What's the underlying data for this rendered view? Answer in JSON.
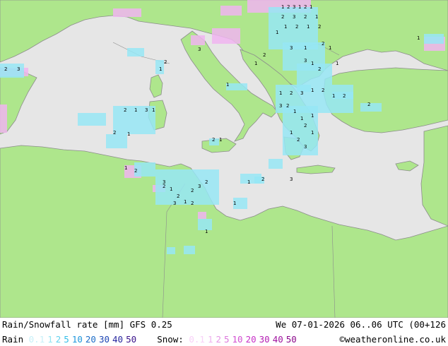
{
  "title": "Rain/Snowfall rate [mm] GFS 0.25",
  "valid_time": "We 07-01-2026 06..06 UTC (00+126",
  "rain_legend": {
    "label": "Rain",
    "items": [
      {
        "text": "0.1",
        "color": "#c8f0f8"
      },
      {
        "text": "1",
        "color": "#96e6f4"
      },
      {
        "text": "2",
        "color": "#64d2ee"
      },
      {
        "text": "5",
        "color": "#32bee8"
      },
      {
        "text": "10",
        "color": "#1e96dc"
      },
      {
        "text": "20",
        "color": "#1e6ec8"
      },
      {
        "text": "30",
        "color": "#1e46b4"
      },
      {
        "text": "40",
        "color": "#2828a0"
      },
      {
        "text": "50",
        "color": "#3c148c"
      }
    ]
  },
  "snow_legend": {
    "label": "Snow:",
    "items": [
      {
        "text": "0.1",
        "color": "#f8d2f8"
      },
      {
        "text": "1",
        "color": "#f0b4f0"
      },
      {
        "text": "2",
        "color": "#e696e6"
      },
      {
        "text": "5",
        "color": "#dc78dc"
      },
      {
        "text": "10",
        "color": "#d250d2"
      },
      {
        "text": "20",
        "color": "#c832c8"
      },
      {
        "text": "30",
        "color": "#b41eb4"
      },
      {
        "text": "40",
        "color": "#a014a0"
      },
      {
        "text": "50",
        "color": "#8c0a8c"
      }
    ]
  },
  "credit": "©weatheronline.co.uk",
  "colors": {
    "land": "#aee68c",
    "sea": "#e6e6e6",
    "border": "#8c8c8c",
    "rain": "#96e6f4",
    "snow": "#f0b4f0"
  },
  "precip_marks": {
    "values": [
      "1",
      "2",
      "3",
      "1",
      "2",
      "1",
      "2",
      "3",
      "2",
      "1",
      "1",
      "2",
      "1",
      "2",
      "3",
      "1",
      "2",
      "1",
      "3",
      "1",
      "2",
      "1"
    ]
  }
}
